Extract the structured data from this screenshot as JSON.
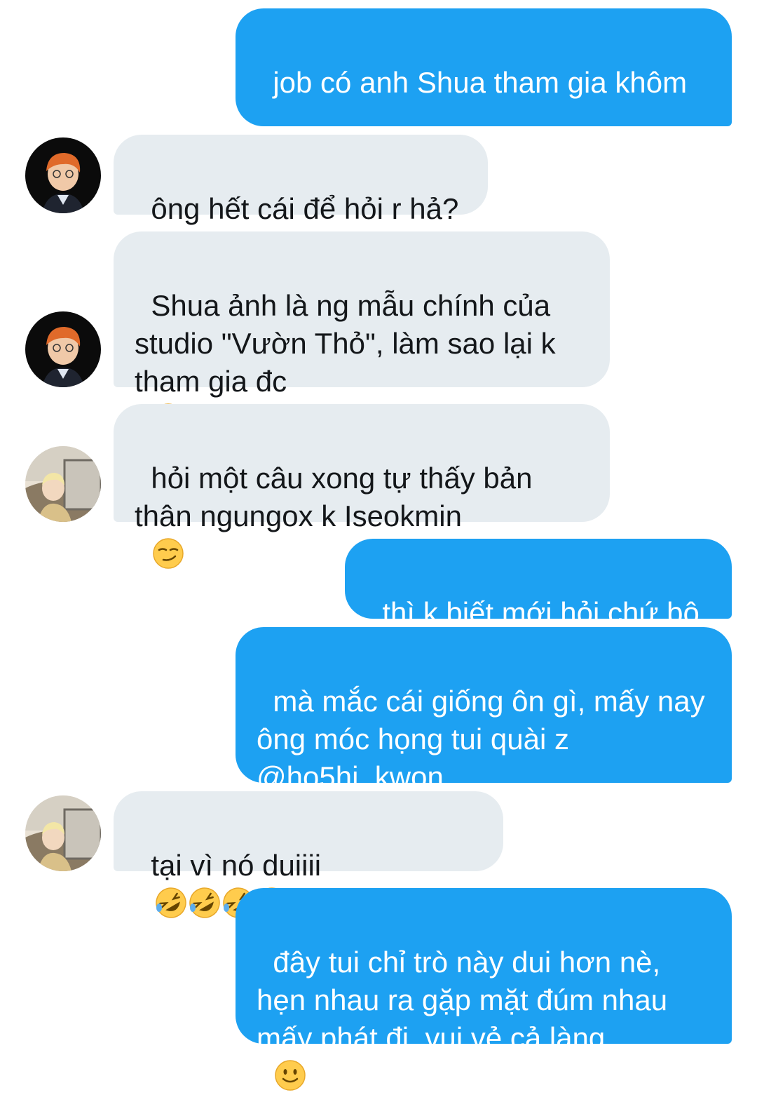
{
  "conversation": {
    "messages": [
      {
        "side": "sent",
        "text": "job có anh Shua tham gia khôm",
        "emoji": "😳"
      },
      {
        "side": "recv",
        "text": "ông hết cái để hỏi r hả?"
      },
      {
        "side": "recv",
        "text": "Shua ảnh là ng mẫu chính của studio \"Vườn Thỏ\", làm sao lại k tham gia đc",
        "emoji": "🙄"
      },
      {
        "side": "recv",
        "text": "hỏi một câu xong tự thấy bản thân ngungox k Iseokmin",
        "emoji": "😏"
      },
      {
        "side": "sent",
        "text": "thì k biết mới hỏi chứ bộ"
      },
      {
        "side": "sent",
        "text": "mà mắc cái giống ôn gì, mấy nay ông móc họng tui quài z @ho5hi_kwon",
        "emoji": "🙂",
        "suffix": "???"
      },
      {
        "side": "recv",
        "text": "tại vì nó duiiii",
        "emoji": "🤣🤣🤣🤣"
      },
      {
        "side": "sent",
        "text": "đây tui chỉ trò này dui hơn nè, hẹn nhau ra gặp mặt đúm nhau mấy phát đi, vui vẻ cả làng",
        "emoji": "🙂"
      }
    ]
  },
  "colors": {
    "sent_bubble": "#1da1f2",
    "received_bubble": "#e6ecf0",
    "received_text": "#14171a",
    "sent_text": "#ffffff"
  },
  "icons": {
    "avatar_a": "user-avatar-orange-hair-icon",
    "avatar_b": "user-avatar-car-window-icon"
  }
}
